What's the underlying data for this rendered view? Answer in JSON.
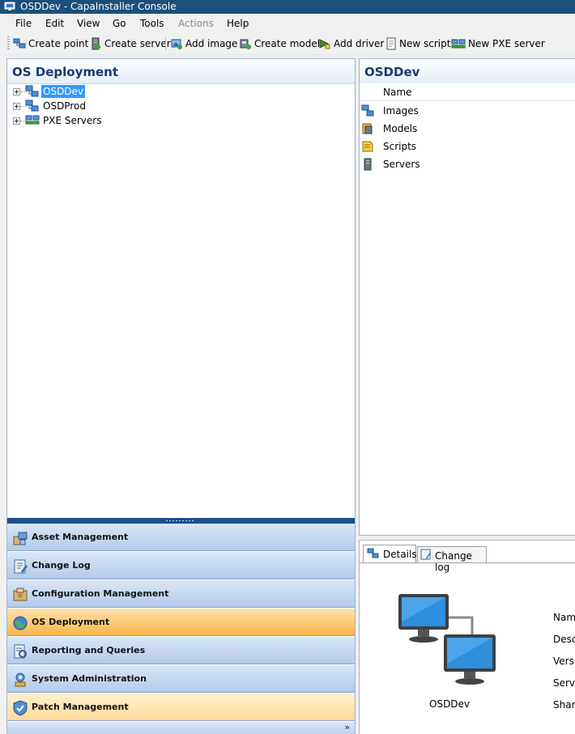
{
  "window": {
    "title": "OSDDev - CapaInstaller Console"
  },
  "menu": [
    "File",
    "Edit",
    "View",
    "Go",
    "Tools",
    "Actions",
    "Help"
  ],
  "toolbar": {
    "create_point": "Create point",
    "create_server": "Create server",
    "add_image": "Add image",
    "create_model": "Create model",
    "add_driver": "Add driver",
    "new_script": "New script",
    "new_pxe_server": "New PXE server"
  },
  "left_pane": {
    "title": "OS Deployment",
    "tree": [
      "OSDDev",
      "OSDProd",
      "PXE Servers"
    ],
    "selected": "OSDDev"
  },
  "nav": {
    "items": [
      "Asset Management",
      "Change Log",
      "Configuration Management",
      "OS Deployment",
      "Reporting and Queries",
      "System Administration",
      "Patch Management"
    ],
    "active": "OS Deployment",
    "more_chevron": "»"
  },
  "right_pane": {
    "title": "OSDDev",
    "column_header": "Name",
    "items": [
      "Images",
      "Models",
      "Scripts",
      "Servers"
    ]
  },
  "details": {
    "tabs": [
      "Details",
      "Change log"
    ],
    "active_tab": "Details",
    "caption": "OSDDev",
    "property_labels": [
      "Nam",
      "Descr",
      "Versi",
      "Serve",
      "Share"
    ]
  },
  "colors": {
    "title_bar": "#1c4f7c",
    "selection": "#3399ff",
    "nav_active": "#f9b54a",
    "pane_title": "#1b3a6e"
  }
}
